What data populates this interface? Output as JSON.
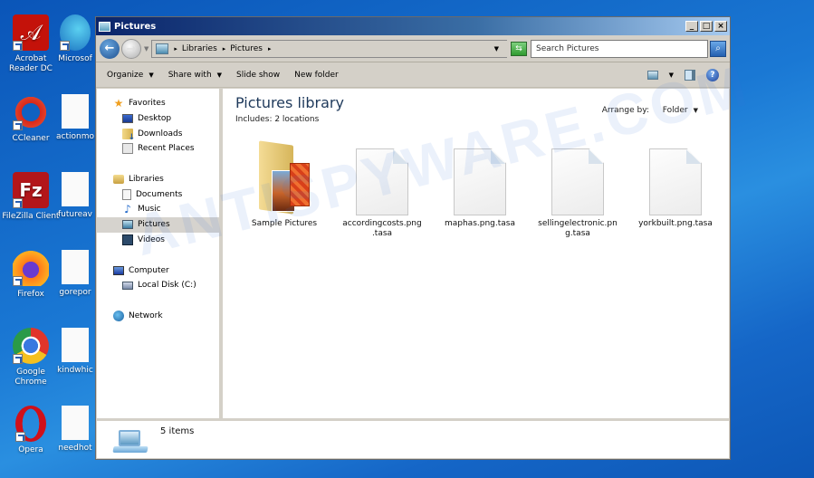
{
  "desktop": {
    "icons": [
      {
        "label": "Acrobat Reader DC",
        "icon": "acrobat-icon"
      },
      {
        "label": "Microsof",
        "icon": "edge-icon"
      },
      {
        "label": "CCleaner",
        "icon": "ccleaner-icon"
      },
      {
        "label": "actionmo",
        "icon": "file-icon"
      },
      {
        "label": "FileZilla Client",
        "icon": "filezilla-icon"
      },
      {
        "label": "futureav",
        "icon": "file-icon"
      },
      {
        "label": "Firefox",
        "icon": "firefox-icon"
      },
      {
        "label": "gorepor",
        "icon": "file-icon"
      },
      {
        "label": "Google Chrome",
        "icon": "chrome-icon"
      },
      {
        "label": "kindwhic",
        "icon": "file-icon"
      },
      {
        "label": "Opera",
        "icon": "opera-icon"
      },
      {
        "label": "needhot",
        "icon": "file-icon"
      }
    ]
  },
  "window": {
    "title": "Pictures",
    "buttons": {
      "minimize": "_",
      "maximize": "□",
      "close": "×"
    },
    "nav": {
      "back_glyph": "←",
      "forward_glyph": "→",
      "breadcrumb": [
        "Libraries",
        "Pictures"
      ],
      "search_placeholder": "Search Pictures"
    },
    "toolbar": {
      "organize": "Organize",
      "share_with": "Share with",
      "slide_show": "Slide show",
      "new_folder": "New folder",
      "help": "?"
    },
    "sidebar": {
      "favorites": {
        "label": "Favorites",
        "items": [
          "Desktop",
          "Downloads",
          "Recent Places"
        ]
      },
      "libraries": {
        "label": "Libraries",
        "items": [
          "Documents",
          "Music",
          "Pictures",
          "Videos"
        ],
        "selected": "Pictures"
      },
      "computer": {
        "label": "Computer",
        "items": [
          "Local Disk (C:)"
        ]
      },
      "network": {
        "label": "Network"
      }
    },
    "content": {
      "title": "Pictures library",
      "includes": "Includes:  2 locations",
      "arrange_label": "Arrange by:",
      "arrange_value": "Folder",
      "files": [
        {
          "name": "Sample Pictures",
          "type": "folder"
        },
        {
          "name": "accordingcosts.png.tasa",
          "display": "accordingcosts.png .tasa",
          "type": "file"
        },
        {
          "name": "maphas.png.tasa",
          "display": "maphas.png.tasa",
          "type": "file"
        },
        {
          "name": "sellingelectronic.png.tasa",
          "display": "sellingelectronic.pn g.tasa",
          "type": "file"
        },
        {
          "name": "yorkbuilt.png.tasa",
          "display": "yorkbuilt.png.tasa",
          "type": "file"
        }
      ]
    },
    "status": {
      "items": "5 items"
    }
  },
  "watermark": "ANTISPYWARE.COM"
}
